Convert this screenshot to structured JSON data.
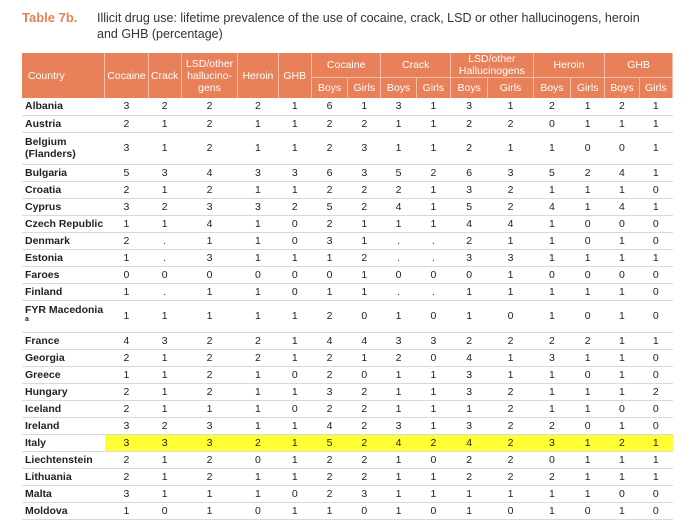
{
  "caption": {
    "label": "Table 7b.",
    "title": "Illicit drug use: lifetime prevalence of the use of cocaine, crack, LSD or other hallucinogens, heroin and GHB (percentage)"
  },
  "header": {
    "country": "Country",
    "total_cols": [
      "Cocaine",
      "Crack",
      "LSD/other hallucino-gens",
      "Heroin",
      "GHB"
    ],
    "group_cols": [
      "Cocaine",
      "Crack",
      "LSD/other Hallucinogens",
      "Heroin",
      "GHB"
    ],
    "sub_cols": [
      "Boys",
      "Girls"
    ]
  },
  "accent_color": "#e8805a",
  "highlight_color": "#ffff33",
  "rows": [
    {
      "country": "Albania",
      "vals": [
        "3",
        "2",
        "2",
        "2",
        "1",
        "6",
        "1",
        "3",
        "1",
        "3",
        "1",
        "2",
        "1",
        "2",
        "1"
      ]
    },
    {
      "country": "Austria",
      "vals": [
        "2",
        "1",
        "2",
        "1",
        "1",
        "2",
        "2",
        "1",
        "1",
        "2",
        "2",
        "0",
        "1",
        "1",
        "1"
      ]
    },
    {
      "country": "Belgium (Flanders)",
      "vals": [
        "3",
        "1",
        "2",
        "1",
        "1",
        "2",
        "3",
        "1",
        "1",
        "2",
        "1",
        "1",
        "0",
        "0",
        "1"
      ],
      "tall": true
    },
    {
      "country": "Bulgaria",
      "vals": [
        "5",
        "3",
        "4",
        "3",
        "3",
        "6",
        "3",
        "5",
        "2",
        "6",
        "3",
        "5",
        "2",
        "4",
        "1"
      ]
    },
    {
      "country": "Croatia",
      "vals": [
        "2",
        "1",
        "2",
        "1",
        "1",
        "2",
        "2",
        "2",
        "1",
        "3",
        "2",
        "1",
        "1",
        "1",
        "0"
      ]
    },
    {
      "country": "Cyprus",
      "vals": [
        "3",
        "2",
        "3",
        "3",
        "2",
        "5",
        "2",
        "4",
        "1",
        "5",
        "2",
        "4",
        "1",
        "4",
        "1"
      ]
    },
    {
      "country": "Czech Republic",
      "vals": [
        "1",
        "1",
        "4",
        "1",
        "0",
        "2",
        "1",
        "1",
        "1",
        "4",
        "4",
        "1",
        "0",
        "0",
        "0"
      ]
    },
    {
      "country": "Denmark",
      "vals": [
        "2",
        ".",
        "1",
        "1",
        "0",
        "3",
        "1",
        ".",
        ".",
        "2",
        "1",
        "1",
        "0",
        "1",
        "0"
      ]
    },
    {
      "country": "Estonia",
      "vals": [
        "1",
        ".",
        "3",
        "1",
        "1",
        "1",
        "2",
        ".",
        ".",
        "3",
        "3",
        "1",
        "1",
        "1",
        "1"
      ]
    },
    {
      "country": "Faroes",
      "vals": [
        "0",
        "0",
        "0",
        "0",
        "0",
        "0",
        "1",
        "0",
        "0",
        "0",
        "1",
        "0",
        "0",
        "0",
        "0"
      ]
    },
    {
      "country": "Finland",
      "vals": [
        "1",
        ".",
        "1",
        "1",
        "0",
        "1",
        "1",
        ".",
        ".",
        "1",
        "1",
        "1",
        "1",
        "1",
        "0"
      ]
    },
    {
      "country": "FYR Macedonia",
      "sup": "a",
      "vals": [
        "1",
        "1",
        "1",
        "1",
        "1",
        "2",
        "0",
        "1",
        "0",
        "1",
        "0",
        "1",
        "0",
        "1",
        "0"
      ],
      "tall": true
    },
    {
      "country": "France",
      "vals": [
        "4",
        "3",
        "2",
        "2",
        "1",
        "4",
        "4",
        "3",
        "3",
        "2",
        "2",
        "2",
        "2",
        "1",
        "1"
      ]
    },
    {
      "country": "Georgia",
      "vals": [
        "2",
        "1",
        "2",
        "2",
        "1",
        "2",
        "1",
        "2",
        "0",
        "4",
        "1",
        "3",
        "1",
        "1",
        "0"
      ]
    },
    {
      "country": "Greece",
      "vals": [
        "1",
        "1",
        "2",
        "1",
        "0",
        "2",
        "0",
        "1",
        "1",
        "3",
        "1",
        "1",
        "0",
        "1",
        "0"
      ]
    },
    {
      "country": "Hungary",
      "vals": [
        "2",
        "1",
        "2",
        "1",
        "1",
        "3",
        "2",
        "1",
        "1",
        "3",
        "2",
        "1",
        "1",
        "1",
        "2"
      ]
    },
    {
      "country": "Iceland",
      "vals": [
        "2",
        "1",
        "1",
        "1",
        "0",
        "2",
        "2",
        "1",
        "1",
        "1",
        "2",
        "1",
        "1",
        "0",
        "0"
      ]
    },
    {
      "country": "Ireland",
      "vals": [
        "3",
        "2",
        "3",
        "1",
        "1",
        "4",
        "2",
        "3",
        "1",
        "3",
        "2",
        "2",
        "0",
        "1",
        "0"
      ]
    },
    {
      "country": "Italy",
      "vals": [
        "3",
        "3",
        "3",
        "2",
        "1",
        "5",
        "2",
        "4",
        "2",
        "4",
        "2",
        "3",
        "1",
        "2",
        "1"
      ],
      "highlight": true
    },
    {
      "country": "Liechtenstein",
      "vals": [
        "2",
        "1",
        "2",
        "0",
        "1",
        "2",
        "2",
        "1",
        "0",
        "2",
        "2",
        "0",
        "1",
        "1",
        "1"
      ]
    },
    {
      "country": "Lithuania",
      "vals": [
        "2",
        "1",
        "2",
        "1",
        "1",
        "2",
        "2",
        "1",
        "1",
        "2",
        "2",
        "2",
        "1",
        "1",
        "1"
      ]
    },
    {
      "country": "Malta",
      "vals": [
        "3",
        "1",
        "1",
        "1",
        "0",
        "2",
        "3",
        "1",
        "1",
        "1",
        "1",
        "1",
        "1",
        "0",
        "0"
      ]
    },
    {
      "country": "Moldova",
      "vals": [
        "1",
        "0",
        "1",
        "0",
        "1",
        "1",
        "0",
        "1",
        "0",
        "1",
        "0",
        "1",
        "0",
        "1",
        "0"
      ]
    }
  ]
}
